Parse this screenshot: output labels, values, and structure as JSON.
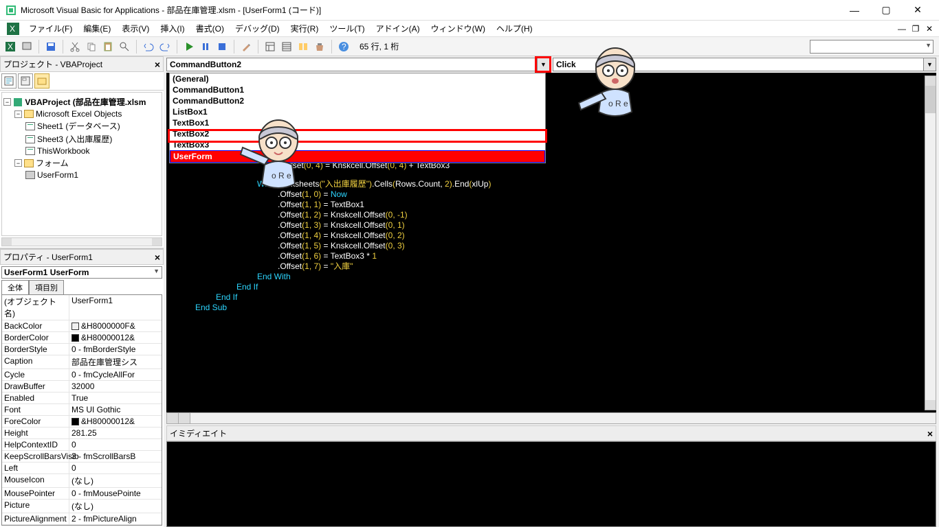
{
  "title": "Microsoft Visual Basic for Applications - 部品在庫管理.xlsm - [UserForm1 (コード)]",
  "menus": {
    "file": "ファイル(F)",
    "edit": "編集(E)",
    "view": "表示(V)",
    "insert": "挿入(I)",
    "format": "書式(O)",
    "debug": "デバッグ(D)",
    "run": "実行(R)",
    "tools": "ツール(T)",
    "addins": "アドイン(A)",
    "window": "ウィンドウ(W)",
    "help": "ヘルプ(H)"
  },
  "toolbar": {
    "location": "65 行, 1 桁"
  },
  "project": {
    "pane_title": "プロジェクト - VBAProject",
    "root": "VBAProject (部品在庫管理.xlsm",
    "excel_objects": "Microsoft Excel Objects",
    "sheets": [
      "Sheet1 (データベース)",
      "Sheet3 (入出庫履歴)",
      "ThisWorkbook"
    ],
    "forms_folder": "フォーム",
    "forms": [
      "UserForm1"
    ]
  },
  "properties": {
    "pane_title": "プロパティ - UserForm1",
    "combo_label": "UserForm1 UserForm",
    "tabs": [
      "全体",
      "項目別"
    ],
    "rows": [
      {
        "n": "(オブジェクト名)",
        "v": "UserForm1"
      },
      {
        "n": "BackColor",
        "v": "&H8000000F&",
        "sw": "#f0f0f0"
      },
      {
        "n": "BorderColor",
        "v": "&H80000012&",
        "sw": "#000000"
      },
      {
        "n": "BorderStyle",
        "v": "0 - fmBorderStyle"
      },
      {
        "n": "Caption",
        "v": "部品在庫管理シス"
      },
      {
        "n": "Cycle",
        "v": "0 - fmCycleAllFor"
      },
      {
        "n": "DrawBuffer",
        "v": "32000"
      },
      {
        "n": "Enabled",
        "v": "True"
      },
      {
        "n": "Font",
        "v": "MS UI Gothic"
      },
      {
        "n": "ForeColor",
        "v": "&H80000012&",
        "sw": "#000000"
      },
      {
        "n": "Height",
        "v": "281.25"
      },
      {
        "n": "HelpContextID",
        "v": "0"
      },
      {
        "n": "KeepScrollBarsVisib",
        "v": "3 - fmScrollBarsB"
      },
      {
        "n": "Left",
        "v": "0"
      },
      {
        "n": "MouseIcon",
        "v": "(なし)"
      },
      {
        "n": "MousePointer",
        "v": "0 - fmMousePointe"
      },
      {
        "n": "Picture",
        "v": "(なし)"
      },
      {
        "n": "PictureAlignment",
        "v": "2 - fmPictureAlign"
      }
    ]
  },
  "code_dropdown": {
    "left_value": "CommandButton2",
    "right_value": "Click",
    "items": [
      "(General)",
      "CommandButton1",
      "CommandButton2",
      "ListBox1",
      "TextBox1",
      "TextBox2",
      "TextBox3",
      "UserForm"
    ]
  },
  "code_lines": [
    {
      "indent": 5,
      "parts": [
        {
          "t": "l.Offset",
          "c": ""
        },
        {
          "t": "(",
          "c": "gold"
        },
        {
          "t": "0, 4",
          "c": "num"
        },
        {
          "t": ")",
          "c": "gold"
        },
        {
          "t": " = Knskcell.Offset",
          "c": ""
        },
        {
          "t": "(",
          "c": "gold"
        },
        {
          "t": "0, 4",
          "c": "num"
        },
        {
          "t": ")",
          "c": "gold"
        },
        {
          "t": " + TextBox3",
          "c": ""
        }
      ]
    },
    {
      "indent": 4,
      "parts": [
        {
          "t": "With",
          "c": "kw"
        },
        {
          "t": " Worksheets",
          "c": ""
        },
        {
          "t": "(",
          "c": "gold"
        },
        {
          "t": "\"入出庫履歴\"",
          "c": "str"
        },
        {
          "t": ")",
          "c": "gold"
        },
        {
          "t": ".Cells",
          "c": ""
        },
        {
          "t": "(",
          "c": "gold"
        },
        {
          "t": "Rows.Count, ",
          "c": ""
        },
        {
          "t": "2",
          "c": "num"
        },
        {
          "t": ")",
          "c": "gold"
        },
        {
          "t": ".End",
          "c": ""
        },
        {
          "t": "(",
          "c": "gold"
        },
        {
          "t": "xlUp",
          "c": ""
        },
        {
          "t": ")",
          "c": "gold"
        }
      ]
    },
    {
      "indent": 5,
      "parts": [
        {
          "t": ".Offset",
          "c": ""
        },
        {
          "t": "(",
          "c": "gold"
        },
        {
          "t": "1, 0",
          "c": "num"
        },
        {
          "t": ")",
          "c": "gold"
        },
        {
          "t": " = ",
          "c": ""
        },
        {
          "t": "Now",
          "c": "kw"
        }
      ]
    },
    {
      "indent": 5,
      "parts": [
        {
          "t": ".Offset",
          "c": ""
        },
        {
          "t": "(",
          "c": "gold"
        },
        {
          "t": "1, 1",
          "c": "num"
        },
        {
          "t": ")",
          "c": "gold"
        },
        {
          "t": " = TextBox1",
          "c": ""
        }
      ]
    },
    {
      "indent": 5,
      "parts": [
        {
          "t": ".Offset",
          "c": ""
        },
        {
          "t": "(",
          "c": "gold"
        },
        {
          "t": "1, 2",
          "c": "num"
        },
        {
          "t": ")",
          "c": "gold"
        },
        {
          "t": " = Knskcell.Offset",
          "c": ""
        },
        {
          "t": "(",
          "c": "gold"
        },
        {
          "t": "0, -1",
          "c": "num"
        },
        {
          "t": ")",
          "c": "gold"
        }
      ]
    },
    {
      "indent": 5,
      "parts": [
        {
          "t": ".Offset",
          "c": ""
        },
        {
          "t": "(",
          "c": "gold"
        },
        {
          "t": "1, 3",
          "c": "num"
        },
        {
          "t": ")",
          "c": "gold"
        },
        {
          "t": " = Knskcell.Offset",
          "c": ""
        },
        {
          "t": "(",
          "c": "gold"
        },
        {
          "t": "0, 1",
          "c": "num"
        },
        {
          "t": ")",
          "c": "gold"
        }
      ]
    },
    {
      "indent": 5,
      "parts": [
        {
          "t": ".Offset",
          "c": ""
        },
        {
          "t": "(",
          "c": "gold"
        },
        {
          "t": "1, 4",
          "c": "num"
        },
        {
          "t": ")",
          "c": "gold"
        },
        {
          "t": " = Knskcell.Offset",
          "c": ""
        },
        {
          "t": "(",
          "c": "gold"
        },
        {
          "t": "0, 2",
          "c": "num"
        },
        {
          "t": ")",
          "c": "gold"
        }
      ]
    },
    {
      "indent": 5,
      "parts": [
        {
          "t": ".Offset",
          "c": ""
        },
        {
          "t": "(",
          "c": "gold"
        },
        {
          "t": "1, 5",
          "c": "num"
        },
        {
          "t": ")",
          "c": "gold"
        },
        {
          "t": " = Knskcell.Offset",
          "c": ""
        },
        {
          "t": "(",
          "c": "gold"
        },
        {
          "t": "0, 3",
          "c": "num"
        },
        {
          "t": ")",
          "c": "gold"
        }
      ]
    },
    {
      "indent": 5,
      "parts": [
        {
          "t": ".Offset",
          "c": ""
        },
        {
          "t": "(",
          "c": "gold"
        },
        {
          "t": "1, 6",
          "c": "num"
        },
        {
          "t": ")",
          "c": "gold"
        },
        {
          "t": " = TextBox3 * ",
          "c": ""
        },
        {
          "t": "1",
          "c": "num"
        }
      ]
    },
    {
      "indent": 5,
      "parts": [
        {
          "t": ".Offset",
          "c": ""
        },
        {
          "t": "(",
          "c": "gold"
        },
        {
          "t": "1, 7",
          "c": "num"
        },
        {
          "t": ")",
          "c": "gold"
        },
        {
          "t": " = ",
          "c": ""
        },
        {
          "t": "\"入庫\"",
          "c": "str"
        }
      ]
    },
    {
      "indent": 4,
      "parts": [
        {
          "t": "End With",
          "c": "kw"
        }
      ]
    },
    {
      "indent": 3,
      "parts": [
        {
          "t": "End If",
          "c": "kw"
        }
      ]
    },
    {
      "indent": 2,
      "parts": [
        {
          "t": "End If",
          "c": "kw"
        }
      ]
    },
    {
      "indent": 1,
      "parts": [
        {
          "t": "End Sub",
          "c": "kw"
        }
      ]
    }
  ],
  "immediate": {
    "title": "イミディエイト"
  }
}
